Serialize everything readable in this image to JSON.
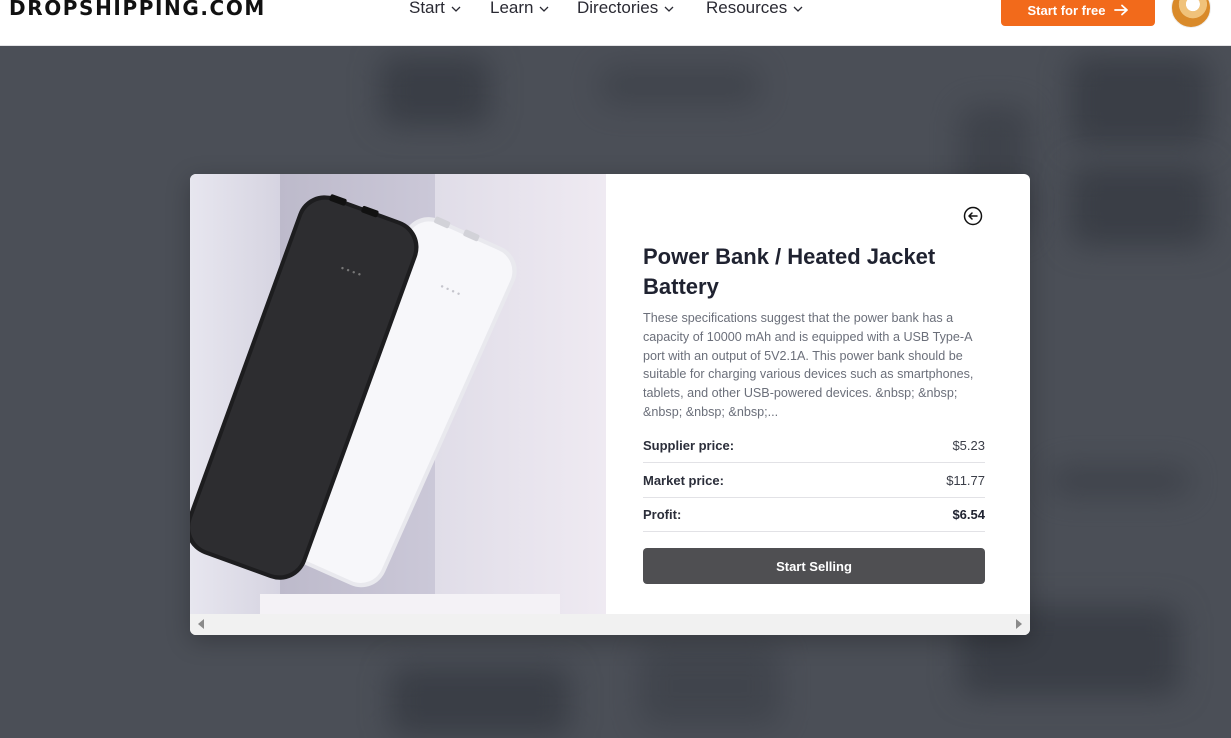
{
  "header": {
    "logo": "DROPSHIPPING.COM",
    "nav": [
      {
        "label": "Start"
      },
      {
        "label": "Learn"
      },
      {
        "label": "Directories"
      },
      {
        "label": "Resources"
      }
    ],
    "cta_label": "Start for free",
    "icons": {
      "chevron": "chevron-down-icon",
      "arrow": "arrow-right-icon",
      "avatar": "user-avatar"
    },
    "colors": {
      "cta": "#f26a1b"
    }
  },
  "modal": {
    "image": "power-bank-photo",
    "back_icon": "arrow-left-circle-icon",
    "title": "Power Bank / Heated Jacket Battery",
    "description": "These specifications suggest that the power bank has a capacity of 10000 mAh and is equipped with a USB Type-A port with an output of 5V2.1A. This power bank should be suitable for charging various devices such as smartphones, tablets, and other USB-powered devices. &nbsp; &nbsp; &nbsp; &nbsp; &nbsp;...",
    "prices": {
      "supplier_label": "Supplier price:",
      "supplier_value": "$5.23",
      "market_label": "Market price:",
      "market_value": "$11.77",
      "profit_label": "Profit:",
      "profit_value": "$6.54"
    },
    "sell_label": "Start Selling",
    "colors": {
      "sell_button": "#4f4f52"
    }
  }
}
